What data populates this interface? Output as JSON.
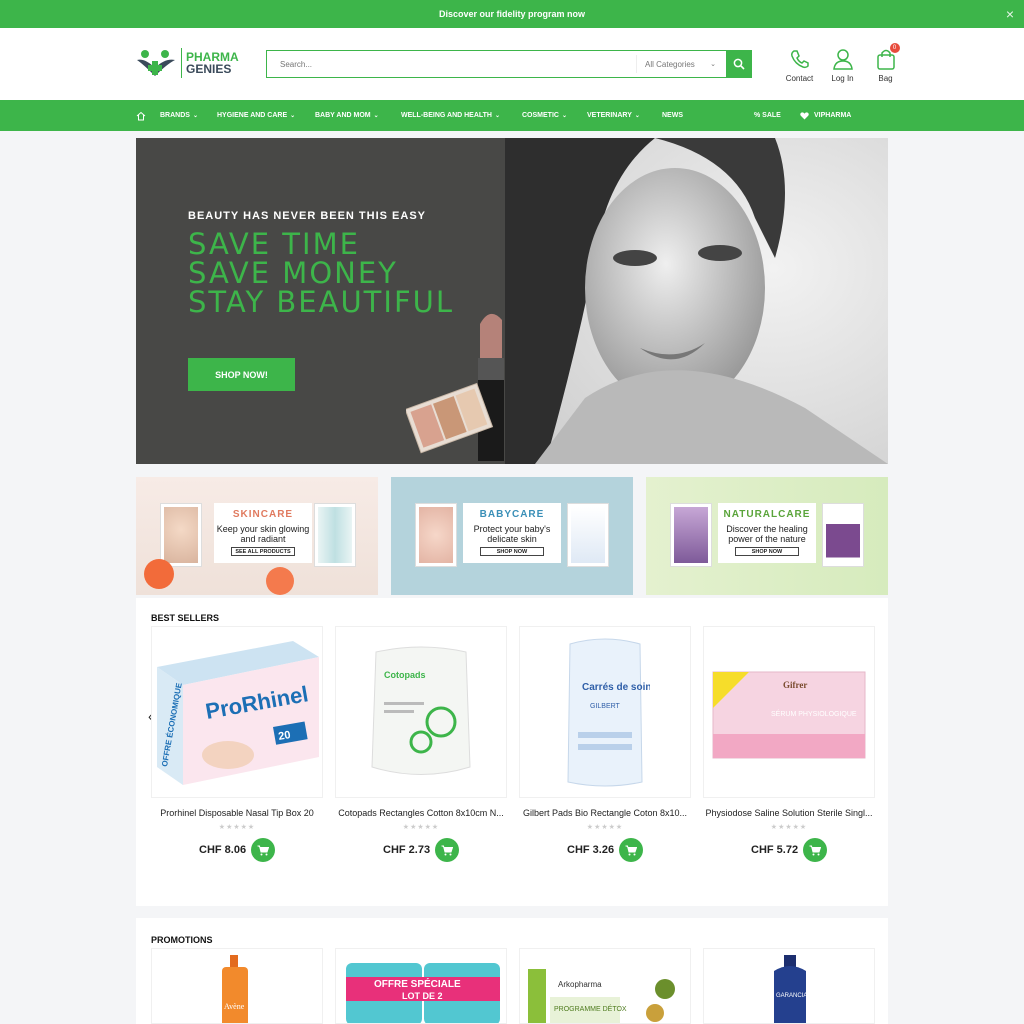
{
  "topbar": {
    "message": "Discover our fidelity program now",
    "close": "×"
  },
  "brand": {
    "line1": "PHARMA",
    "line2": "GENIES"
  },
  "search": {
    "placeholder": "Search...",
    "category": "All Categories"
  },
  "header_icons": [
    {
      "label": "Contact",
      "icon": "phone-icon"
    },
    {
      "label": "Log In",
      "icon": "user-icon"
    },
    {
      "label": "Bag",
      "icon": "bag-icon",
      "count": "0"
    }
  ],
  "nav": {
    "home_icon": "home-icon",
    "items": [
      "BRANDS",
      "HYGIENE AND CARE",
      "BABY AND MOM",
      "WELL-BEING AND HEALTH",
      "COSMETIC",
      "VETERINARY",
      "NEWS"
    ],
    "sale": "% SALE",
    "vipharma": "VIPHARMA"
  },
  "hero": {
    "kicker": "BEAUTY HAS NEVER BEEN THIS EASY",
    "line1": "SAVE TIME",
    "line2": "SAVE MONEY",
    "line3": "STAY BEAUTIFUL",
    "cta": "SHOP NOW!"
  },
  "banners": [
    {
      "title": "SKINCARE",
      "text": "Keep your skin glowing and radiant",
      "cta": "SEE ALL PRODUCTS",
      "title_color": "#e07a5f"
    },
    {
      "title": "BABYCARE",
      "text": "Protect your baby's delicate skin",
      "cta": "SHOP NOW",
      "title_color": "#3a8fb7"
    },
    {
      "title": "NATURALCARE",
      "text": "Discover the healing power of the nature",
      "cta": "SHOP NOW",
      "title_color": "#5aa43a"
    }
  ],
  "best_sellers": {
    "title": "BEST SELLERS",
    "products": [
      {
        "name": "Prorhinel Disposable Nasal Tip Box 20",
        "price": "CHF 8.06",
        "stars": "★★★★★"
      },
      {
        "name": "Cotopads Rectangles Cotton 8x10cm N...",
        "price": "CHF 2.73",
        "stars": "★★★★★"
      },
      {
        "name": "Gilbert Pads Bio Rectangle Coton 8x10...",
        "price": "CHF 3.26",
        "stars": "★★★★★"
      },
      {
        "name": "Physiodose Saline Solution Sterile Singl...",
        "price": "CHF 5.72",
        "stars": "★★★★★"
      }
    ]
  },
  "promotions": {
    "title": "PROMOTIONS"
  },
  "package_text": {
    "prorhinel": "ProRhinel",
    "offre": "OFFRE ÉCONOMIQUE",
    "count": "20",
    "cotopads": "Cotopads",
    "carres": "Carrés de soin",
    "gilbert": "GILBERT",
    "serum": "SÉRUM PHYSIOLOGIQUE",
    "gifrer": "Gifrer",
    "avene": "Avène",
    "offre_speciale": "OFFRE SPÉCIALE",
    "lot": "LOT DE 2",
    "arkopharma": "Arkopharma",
    "programme": "PROGRAMME DÉTOX",
    "garancia": "GARANCIA"
  }
}
